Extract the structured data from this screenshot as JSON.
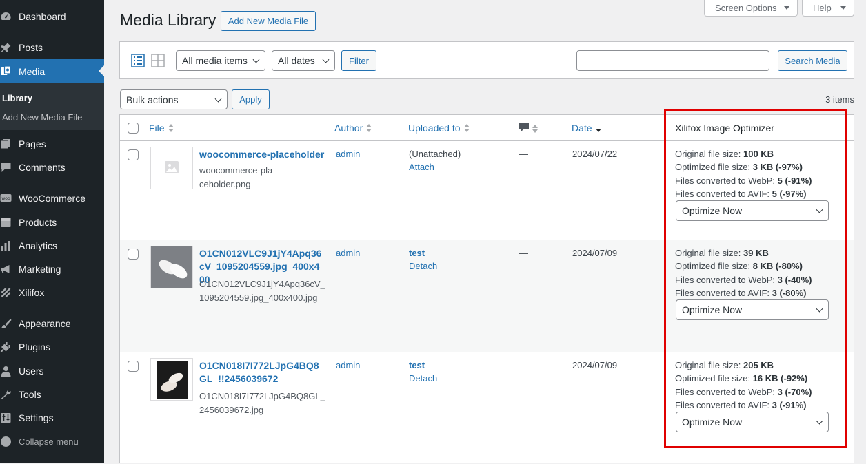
{
  "sidebar": {
    "items": [
      {
        "label": "Dashboard",
        "icon": "dashboard-icon"
      },
      {
        "label": "Posts",
        "icon": "pin-icon"
      },
      {
        "label": "Media",
        "icon": "media-icon"
      },
      {
        "label": "Pages",
        "icon": "pages-icon"
      },
      {
        "label": "Comments",
        "icon": "comments-icon"
      },
      {
        "label": "WooCommerce",
        "icon": "woocommerce-icon"
      },
      {
        "label": "Products",
        "icon": "products-icon"
      },
      {
        "label": "Analytics",
        "icon": "analytics-icon"
      },
      {
        "label": "Marketing",
        "icon": "megaphone-icon"
      },
      {
        "label": "Xilifox",
        "icon": "xilifox-icon"
      },
      {
        "label": "Appearance",
        "icon": "brush-icon"
      },
      {
        "label": "Plugins",
        "icon": "plug-icon"
      },
      {
        "label": "Users",
        "icon": "users-icon"
      },
      {
        "label": "Tools",
        "icon": "wrench-icon"
      },
      {
        "label": "Settings",
        "icon": "sliders-icon"
      }
    ],
    "submenu": [
      "Library",
      "Add New Media File"
    ],
    "collapse": "Collapse menu"
  },
  "header": {
    "title": "Media Library",
    "add_new": "Add New Media File",
    "screen_options": "Screen Options",
    "help": "Help"
  },
  "toolbar": {
    "filter_type": "All media items",
    "filter_date": "All dates",
    "filter_button": "Filter",
    "search_button": "Search Media",
    "search_value": ""
  },
  "bulk": {
    "select": "Bulk actions",
    "apply": "Apply",
    "count": "3 items"
  },
  "columns": {
    "file": "File",
    "author": "Author",
    "uploaded_to": "Uploaded to",
    "date": "Date",
    "optimizer": "Xilifox Image Optimizer"
  },
  "optimizer_labels": {
    "original": "Original file size: ",
    "optimized": "Optimized file size: ",
    "webp": "Files converted to WebP: ",
    "avif": "Files converted to AVIF: ",
    "action": "Optimize Now"
  },
  "rows": [
    {
      "title": "woocommerce-placeholder",
      "filename": "woocommerce-placeholder.png",
      "author": "admin",
      "uploaded_status": "(Unattached)",
      "uploaded_action": "Attach",
      "comments": "—",
      "date": "2024/07/22",
      "original": "100 KB",
      "optimized": "3 KB (-97%)",
      "webp": "5 (-91%)",
      "avif": "5 (-97%)"
    },
    {
      "title": "O1CN012VLC9J1jY4Apq36cV_1095204559.jpg_400x400",
      "filename": "O1CN012VLC9J1jY4Apq36cV_1095204559.jpg_400x400.jpg",
      "author": "admin",
      "uploaded_status": "test",
      "uploaded_action": "Detach",
      "comments": "—",
      "date": "2024/07/09",
      "original": "39 KB",
      "optimized": "8 KB (-80%)",
      "webp": "3 (-40%)",
      "avif": "3 (-80%)"
    },
    {
      "title": "O1CN018I7I772LJpG4BQ8GL_!!2456039672",
      "filename": "O1CN018I7I772LJpG4BQ8GL_2456039672.jpg",
      "author": "admin",
      "uploaded_status": "test",
      "uploaded_action": "Detach",
      "comments": "—",
      "date": "2024/07/09",
      "original": "205 KB",
      "optimized": "16 KB (-92%)",
      "webp": "3 (-70%)",
      "avif": "3 (-91%)"
    }
  ]
}
